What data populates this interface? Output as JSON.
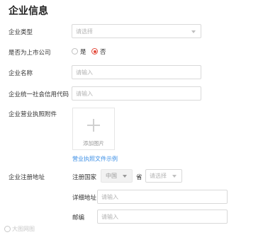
{
  "form": {
    "title": "企业信息",
    "company_type": {
      "label": "企业类型",
      "placeholder": "请选择"
    },
    "listed": {
      "label": "是否为上市公司",
      "options": [
        {
          "label": "是",
          "checked": false
        },
        {
          "label": "否",
          "checked": true
        }
      ]
    },
    "company_name": {
      "label": "企业名称",
      "placeholder": "请输入"
    },
    "credit_code": {
      "label": "企业统一社会信用代码",
      "placeholder": "请输入"
    },
    "license": {
      "label": "企业营业执照附件",
      "upload_text": "添加图片",
      "example_link": "营业执照文件示例"
    },
    "address": {
      "label": "企业注册地址",
      "country_label": "注册国家",
      "country_value": "中国",
      "province_label": "省",
      "province_placeholder": "请选择",
      "detail_label": "详细地址",
      "detail_placeholder": "请输入",
      "zip_label": "邮编",
      "zip_placeholder": "请输入"
    }
  },
  "watermark": "大图网图",
  "colors": {
    "accent_red": "#e34b3c",
    "link_blue": "#3a8ee6",
    "border": "#d9d9d9"
  },
  "icons": {
    "select_caret": "chevron-down-icon",
    "upload": "plus-icon"
  }
}
